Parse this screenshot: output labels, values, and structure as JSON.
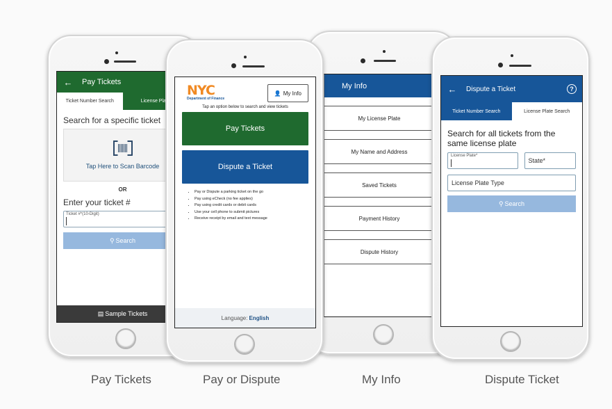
{
  "colors": {
    "green": "#1f6a2f",
    "blue": "#175699",
    "nyc_orange": "#f08a24",
    "search_disabled": "#96b8de"
  },
  "captions": [
    "Pay Tickets",
    "Pay or Dispute",
    "My Info",
    "Dispute Ticket"
  ],
  "pay_tickets": {
    "header_title": "Pay Tickets",
    "back_icon": "←",
    "tabs": [
      "Ticket Number Search",
      "License Plate"
    ],
    "heading": "Search for a specific ticket",
    "scan_label": "Tap Here to Scan Barcode",
    "or": "OR",
    "enter_label": "Enter your ticket #",
    "input_label": "Ticket #*(10-Digit)",
    "search_button": "Search",
    "footer": "Sample Tickets"
  },
  "home": {
    "logo": "NYC",
    "logo_sub": "Department of Finance",
    "my_info_button": "My Info",
    "tap_text": "Tap an option below to search and view tickets",
    "pay_button": "Pay Tickets",
    "dispute_button": "Dispute a Ticket",
    "bullets": [
      "Pay or Dispute a parking ticket on the go",
      "Pay using eCheck (no fee applies)",
      "Pay using credit cards or debit cards",
      "Use your cell phone to submit pictures",
      "Receive receipt by email and text message"
    ],
    "language_label": "Language:",
    "language_value": "English"
  },
  "my_info": {
    "header_title": "My Info",
    "items": [
      "My License Plate",
      "My Name and Address",
      "Saved Tickets",
      "Payment History",
      "Dispute History"
    ]
  },
  "dispute": {
    "header_title": "Dispute a Ticket",
    "back_icon": "←",
    "help_icon": "?",
    "tabs": [
      "Ticket Number Search",
      "License Plate Search"
    ],
    "heading": "Search for all tickets from the same license plate",
    "plate_label": "License Plate*",
    "state_label": "State*",
    "plate_type": "License Plate Type",
    "search_button": "Search"
  }
}
